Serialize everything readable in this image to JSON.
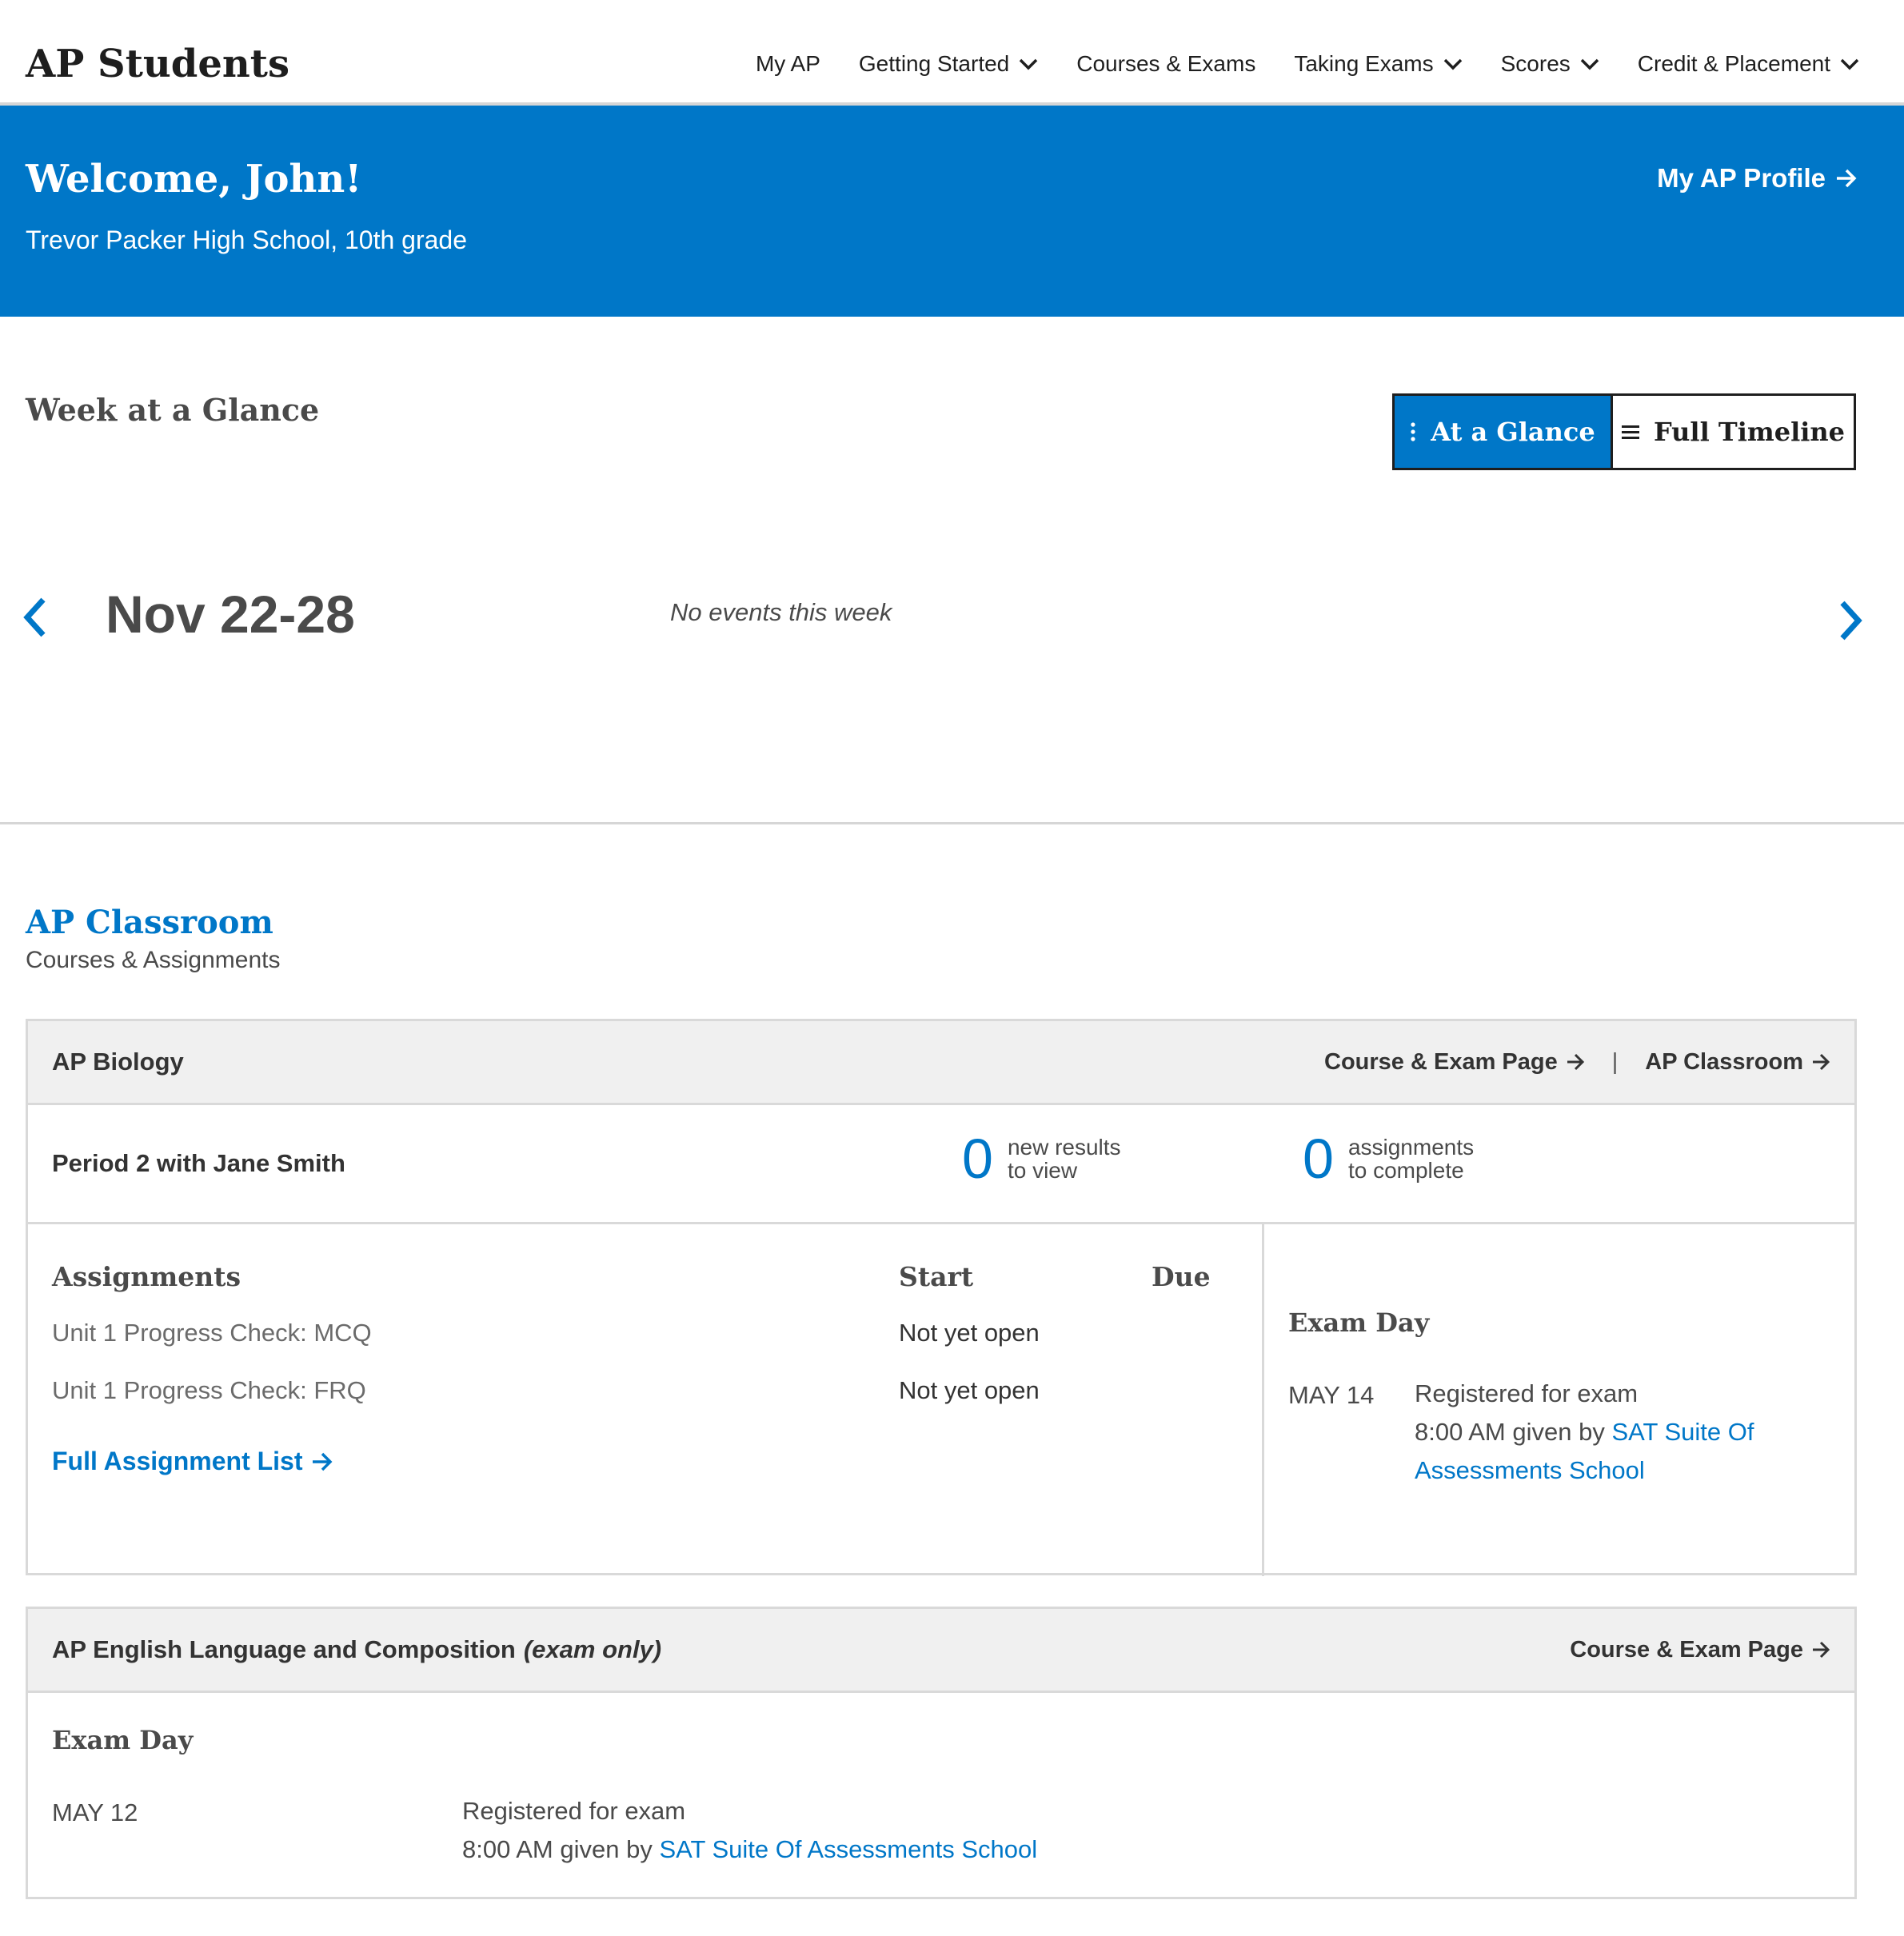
{
  "header": {
    "brand": "AP Students",
    "nav": [
      {
        "label": "My AP",
        "dropdown": false
      },
      {
        "label": "Getting Started",
        "dropdown": true
      },
      {
        "label": "Courses & Exams",
        "dropdown": false
      },
      {
        "label": "Taking Exams",
        "dropdown": true
      },
      {
        "label": "Scores",
        "dropdown": true
      },
      {
        "label": "Credit & Placement",
        "dropdown": true
      }
    ]
  },
  "banner": {
    "welcome": "Welcome, John!",
    "school": "Trevor Packer High School, 10th grade",
    "profile_link": "My AP Profile",
    "color": "#0077c8"
  },
  "week": {
    "title": "Week at a Glance",
    "toggle": {
      "active": "At a Glance",
      "inactive": "Full Timeline"
    },
    "range": "Nov 22-28",
    "empty_message": "No events this week"
  },
  "classroom": {
    "title": "AP Classroom",
    "subtitle": "Courses & Assignments",
    "courses": [
      {
        "name": "AP Biology",
        "links": [
          "Course & Exam Page",
          "AP Classroom"
        ],
        "period": "Period 2 with Jane Smith",
        "new_results": {
          "count": "0",
          "line1": "new results",
          "line2": "to view"
        },
        "assignments_to_complete": {
          "count": "0",
          "line1": "assignments",
          "line2": "to complete"
        },
        "assignments": {
          "headers": {
            "name": "Assignments",
            "start": "Start",
            "due": "Due"
          },
          "rows": [
            {
              "name": "Unit 1 Progress Check: MCQ",
              "start": "Not yet open",
              "due": ""
            },
            {
              "name": "Unit 1 Progress Check: FRQ",
              "start": "Not yet open",
              "due": ""
            }
          ],
          "full_list_link": "Full Assignment List"
        },
        "exam": {
          "title": "Exam Day",
          "date": "MAY 14",
          "status": "Registered for exam",
          "given_prefix": "8:00 AM given by",
          "location_line1": "SAT Suite Of",
          "location_line2": "Assessments School"
        }
      },
      {
        "name": "AP English Language and Composition",
        "name_suffix": "(exam only)",
        "links": [
          "Course & Exam Page"
        ],
        "exam": {
          "title": "Exam Day",
          "date": "MAY 12",
          "status": "Registered for exam",
          "given_prefix": "8:00 AM given by",
          "location": "SAT Suite Of Assessments School"
        }
      }
    ]
  }
}
